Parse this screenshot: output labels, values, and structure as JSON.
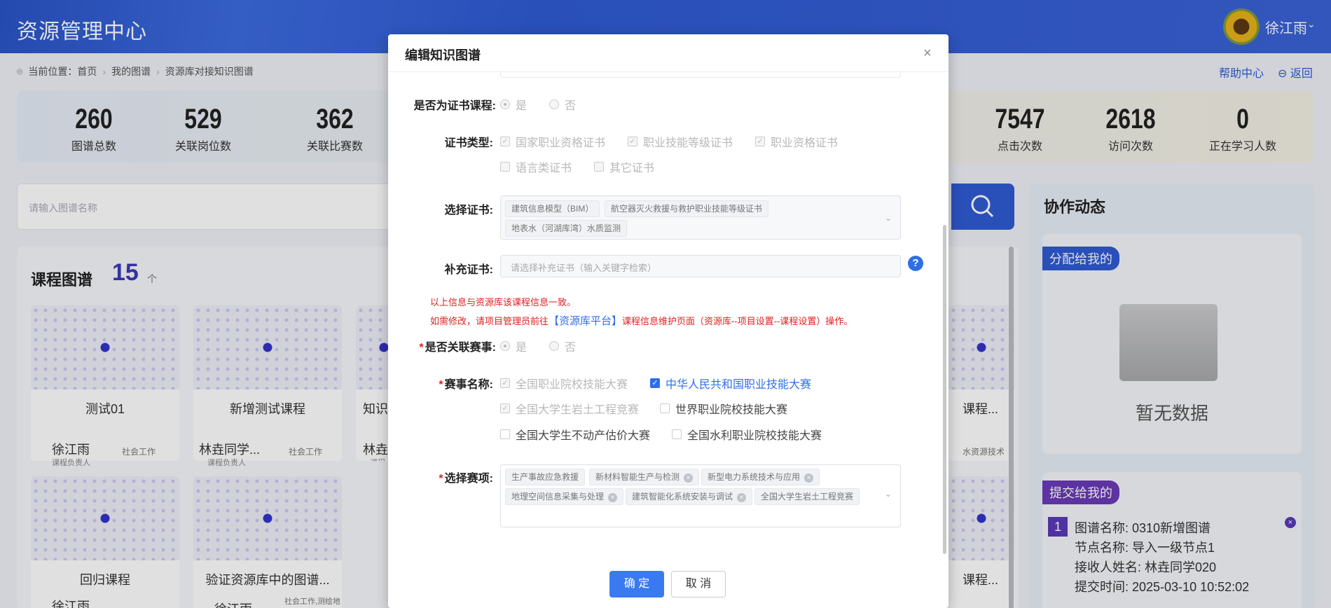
{
  "app": {
    "title": "资源管理中心",
    "user": "徐江雨"
  },
  "breadcrumb": {
    "prefix": "当前位置：",
    "items": [
      "首页",
      "我的图谱",
      "资源库对接知识图谱"
    ]
  },
  "header_links": {
    "help": "帮助中心",
    "back": "返回"
  },
  "stats": [
    {
      "num": "260",
      "label": "图谱总数"
    },
    {
      "num": "529",
      "label": "关联岗位数"
    },
    {
      "num": "362",
      "label": "关联比赛数"
    },
    {
      "num": "7547",
      "label": "点击次数"
    },
    {
      "num": "2618",
      "label": "访问次数"
    },
    {
      "num": "0",
      "label": "正在学习人数"
    }
  ],
  "search": {
    "placeholder": "请输入图谱名称"
  },
  "courses": {
    "title": "课程图谱",
    "count": "15",
    "unit": "个",
    "cards": [
      {
        "name": "测试01",
        "owner": "徐江雨",
        "role": "课程负责人",
        "tag": "社会工作"
      },
      {
        "name": "新增测试课程",
        "owner": "林垚同学...",
        "role": "课程负责人",
        "tag": "社会工作"
      },
      {
        "name": "回归课程",
        "owner": "徐江雨",
        "role": "",
        "tag": ""
      },
      {
        "name": "验证资源库中的图谱...",
        "owner": "徐江雨",
        "role": "",
        "tag": "社会工作,测绘地"
      }
    ],
    "partial": {
      "name1": "知识",
      "owner1": "林垚",
      "role1": "课程",
      "name2": "课程...",
      "tag2": "水资源技术",
      "name3": "课程..."
    }
  },
  "collab": {
    "title": "协作动态",
    "assigned_label": "分配给我的",
    "empty_text": "暂无数据",
    "submitted_label": "提交给我的",
    "submitted_item": {
      "index": "1",
      "lines": [
        "图谱名称:   0310新增图谱",
        "节点名称:   导入一级节点1",
        "接收人姓名:   林垚同学020",
        "提交时间:   2025-03-10 10:52:02"
      ]
    }
  },
  "modal": {
    "title": "编辑知识图谱",
    "cert_course": {
      "label": "是否为证书课程:",
      "yes": "是",
      "no": "否"
    },
    "cert_type": {
      "label": "证书类型:",
      "options": [
        "国家职业资格证书",
        "职业技能等级证书",
        "职业资格证书",
        "语言类证书",
        "其它证书"
      ]
    },
    "select_cert": {
      "label": "选择证书:",
      "chips": [
        "建筑信息模型（BIM）",
        "航空器灭火救援与救护职业技能等级证书",
        "地表水（河湖库湾）水质监测"
      ]
    },
    "extra_cert": {
      "label": "补充证书:",
      "placeholder": "请选择补充证书（输入关键字检索）"
    },
    "notes": {
      "line1": "以上信息与资源库该课程信息一致。",
      "line2_a": "如需修改，请项目管理员前往",
      "line2_link": "【资源库平台】",
      "line2_b": "课程信息维护页面（资源库--项目设置--课程设置）操作。"
    },
    "related_contest": {
      "label": "是否关联赛事:",
      "yes": "是",
      "no": "否"
    },
    "contest_name": {
      "label": "赛事名称:",
      "options": [
        "全国职业院校技能大赛",
        "中华人民共和国职业技能大赛",
        "全国大学生岩土工程竞赛",
        "世界职业院校技能大赛",
        "全国大学生不动产估价大赛",
        "全国水利职业院校技能大赛"
      ]
    },
    "contest_item": {
      "label": "选择赛项:",
      "chips": [
        "生产事故应急救援",
        "新材料智能生产与检测",
        "新型电力系统技术与应用",
        "地理空间信息采集与处理",
        "建筑智能化系统安装与调试",
        "全国大学生岩土工程竞赛"
      ]
    },
    "ok": "确 定",
    "cancel": "取 消"
  },
  "colors": {
    "brand": "#2f5bd3",
    "accent": "#3a7af0",
    "error": "#e02020",
    "purple": "#5b3ab8"
  }
}
